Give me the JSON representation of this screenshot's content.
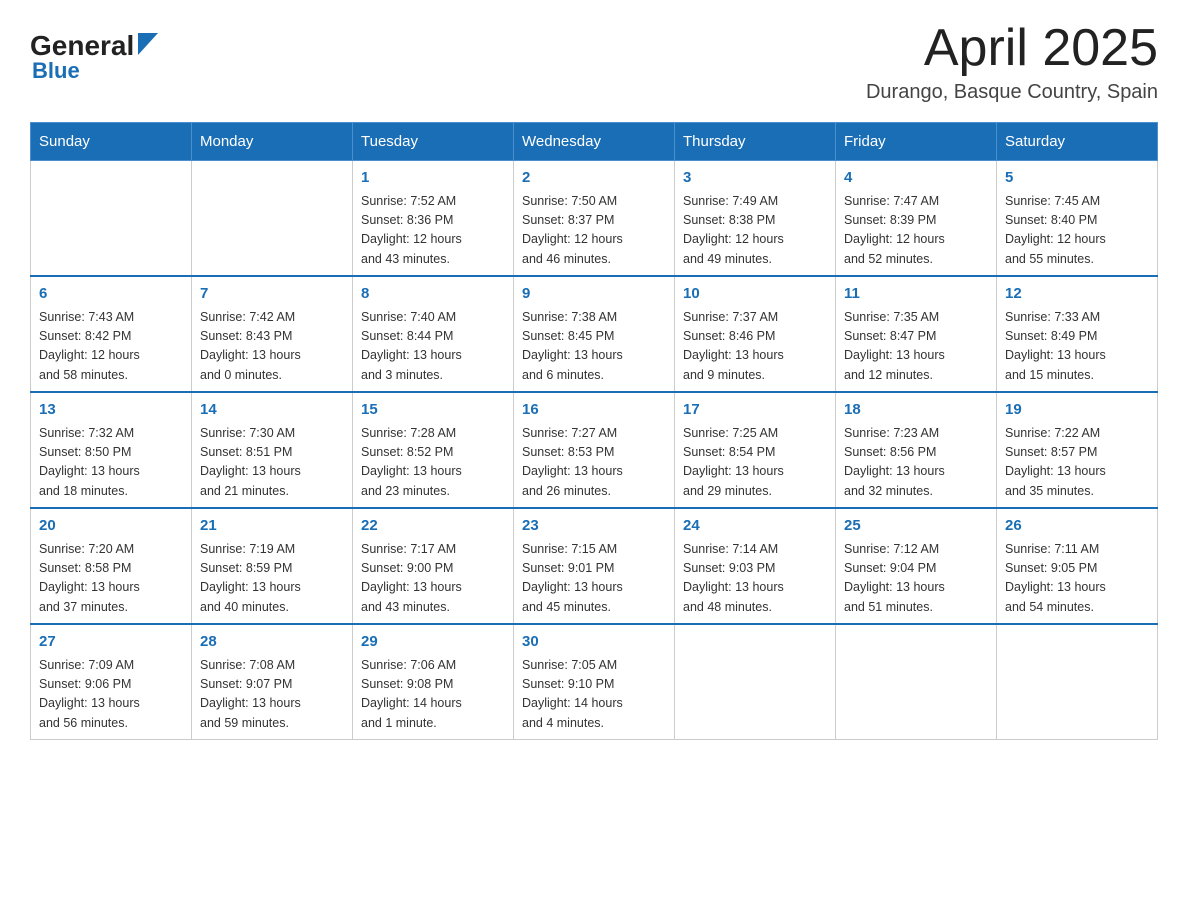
{
  "header": {
    "logo_general": "General",
    "logo_blue": "Blue",
    "month_title": "April 2025",
    "location": "Durango, Basque Country, Spain"
  },
  "weekdays": [
    "Sunday",
    "Monday",
    "Tuesday",
    "Wednesday",
    "Thursday",
    "Friday",
    "Saturday"
  ],
  "weeks": [
    [
      {
        "day": "",
        "info": ""
      },
      {
        "day": "",
        "info": ""
      },
      {
        "day": "1",
        "info": "Sunrise: 7:52 AM\nSunset: 8:36 PM\nDaylight: 12 hours\nand 43 minutes."
      },
      {
        "day": "2",
        "info": "Sunrise: 7:50 AM\nSunset: 8:37 PM\nDaylight: 12 hours\nand 46 minutes."
      },
      {
        "day": "3",
        "info": "Sunrise: 7:49 AM\nSunset: 8:38 PM\nDaylight: 12 hours\nand 49 minutes."
      },
      {
        "day": "4",
        "info": "Sunrise: 7:47 AM\nSunset: 8:39 PM\nDaylight: 12 hours\nand 52 minutes."
      },
      {
        "day": "5",
        "info": "Sunrise: 7:45 AM\nSunset: 8:40 PM\nDaylight: 12 hours\nand 55 minutes."
      }
    ],
    [
      {
        "day": "6",
        "info": "Sunrise: 7:43 AM\nSunset: 8:42 PM\nDaylight: 12 hours\nand 58 minutes."
      },
      {
        "day": "7",
        "info": "Sunrise: 7:42 AM\nSunset: 8:43 PM\nDaylight: 13 hours\nand 0 minutes."
      },
      {
        "day": "8",
        "info": "Sunrise: 7:40 AM\nSunset: 8:44 PM\nDaylight: 13 hours\nand 3 minutes."
      },
      {
        "day": "9",
        "info": "Sunrise: 7:38 AM\nSunset: 8:45 PM\nDaylight: 13 hours\nand 6 minutes."
      },
      {
        "day": "10",
        "info": "Sunrise: 7:37 AM\nSunset: 8:46 PM\nDaylight: 13 hours\nand 9 minutes."
      },
      {
        "day": "11",
        "info": "Sunrise: 7:35 AM\nSunset: 8:47 PM\nDaylight: 13 hours\nand 12 minutes."
      },
      {
        "day": "12",
        "info": "Sunrise: 7:33 AM\nSunset: 8:49 PM\nDaylight: 13 hours\nand 15 minutes."
      }
    ],
    [
      {
        "day": "13",
        "info": "Sunrise: 7:32 AM\nSunset: 8:50 PM\nDaylight: 13 hours\nand 18 minutes."
      },
      {
        "day": "14",
        "info": "Sunrise: 7:30 AM\nSunset: 8:51 PM\nDaylight: 13 hours\nand 21 minutes."
      },
      {
        "day": "15",
        "info": "Sunrise: 7:28 AM\nSunset: 8:52 PM\nDaylight: 13 hours\nand 23 minutes."
      },
      {
        "day": "16",
        "info": "Sunrise: 7:27 AM\nSunset: 8:53 PM\nDaylight: 13 hours\nand 26 minutes."
      },
      {
        "day": "17",
        "info": "Sunrise: 7:25 AM\nSunset: 8:54 PM\nDaylight: 13 hours\nand 29 minutes."
      },
      {
        "day": "18",
        "info": "Sunrise: 7:23 AM\nSunset: 8:56 PM\nDaylight: 13 hours\nand 32 minutes."
      },
      {
        "day": "19",
        "info": "Sunrise: 7:22 AM\nSunset: 8:57 PM\nDaylight: 13 hours\nand 35 minutes."
      }
    ],
    [
      {
        "day": "20",
        "info": "Sunrise: 7:20 AM\nSunset: 8:58 PM\nDaylight: 13 hours\nand 37 minutes."
      },
      {
        "day": "21",
        "info": "Sunrise: 7:19 AM\nSunset: 8:59 PM\nDaylight: 13 hours\nand 40 minutes."
      },
      {
        "day": "22",
        "info": "Sunrise: 7:17 AM\nSunset: 9:00 PM\nDaylight: 13 hours\nand 43 minutes."
      },
      {
        "day": "23",
        "info": "Sunrise: 7:15 AM\nSunset: 9:01 PM\nDaylight: 13 hours\nand 45 minutes."
      },
      {
        "day": "24",
        "info": "Sunrise: 7:14 AM\nSunset: 9:03 PM\nDaylight: 13 hours\nand 48 minutes."
      },
      {
        "day": "25",
        "info": "Sunrise: 7:12 AM\nSunset: 9:04 PM\nDaylight: 13 hours\nand 51 minutes."
      },
      {
        "day": "26",
        "info": "Sunrise: 7:11 AM\nSunset: 9:05 PM\nDaylight: 13 hours\nand 54 minutes."
      }
    ],
    [
      {
        "day": "27",
        "info": "Sunrise: 7:09 AM\nSunset: 9:06 PM\nDaylight: 13 hours\nand 56 minutes."
      },
      {
        "day": "28",
        "info": "Sunrise: 7:08 AM\nSunset: 9:07 PM\nDaylight: 13 hours\nand 59 minutes."
      },
      {
        "day": "29",
        "info": "Sunrise: 7:06 AM\nSunset: 9:08 PM\nDaylight: 14 hours\nand 1 minute."
      },
      {
        "day": "30",
        "info": "Sunrise: 7:05 AM\nSunset: 9:10 PM\nDaylight: 14 hours\nand 4 minutes."
      },
      {
        "day": "",
        "info": ""
      },
      {
        "day": "",
        "info": ""
      },
      {
        "day": "",
        "info": ""
      }
    ]
  ]
}
